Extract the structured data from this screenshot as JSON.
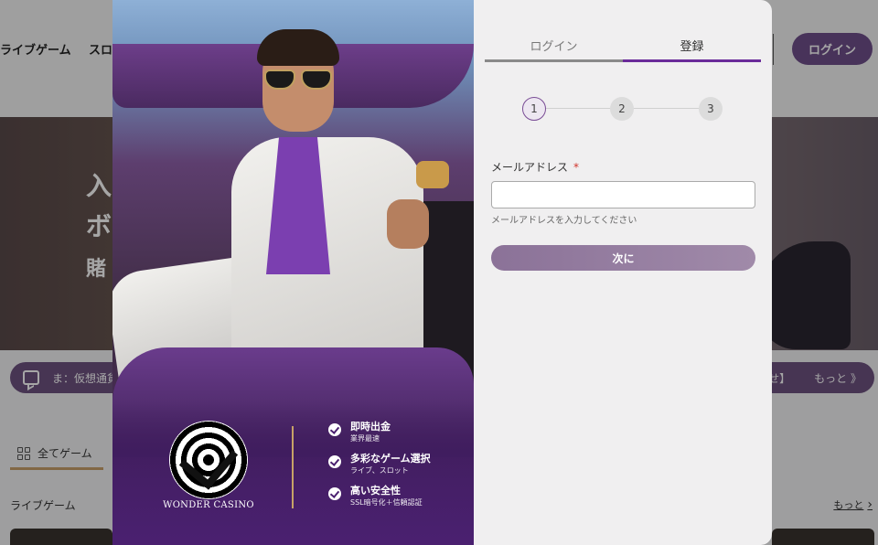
{
  "background": {
    "nav": {
      "live_games": "ライブゲーム",
      "slots_partial": "スロ"
    },
    "header_login_button": "ログイン",
    "hero_lines": [
      "入",
      "ボ",
      "賭"
    ],
    "ticker": {
      "text": "ま：仮想通貨",
      "notice_partial": "らせ】",
      "more": "もっと 》"
    },
    "category_tab": "全てゲーム",
    "section_title": "ライブゲーム",
    "section_more": "もっと"
  },
  "modal": {
    "promo": {
      "logo_text": "WONDER CASINO",
      "features": [
        {
          "title": "即時出金",
          "subtitle": "業界最速"
        },
        {
          "title": "多彩なゲーム選択",
          "subtitle": "ライブ、スロット"
        },
        {
          "title": "高い安全性",
          "subtitle": "SSL暗号化＋信頼認証"
        }
      ]
    },
    "form": {
      "tabs": {
        "login": "ログイン",
        "register": "登録",
        "active": "register"
      },
      "steps": [
        "1",
        "2",
        "3"
      ],
      "current_step": 1,
      "email_label": "メールアドレス",
      "required_mark": "*",
      "email_value": "",
      "email_hint": "メールアドレスを入力してください",
      "next_button": "次に"
    }
  },
  "colors": {
    "accent_purple": "#6a2b9a",
    "button_muted": "#9a84a5",
    "gold": "#c7a267",
    "required": "#d0342c"
  }
}
